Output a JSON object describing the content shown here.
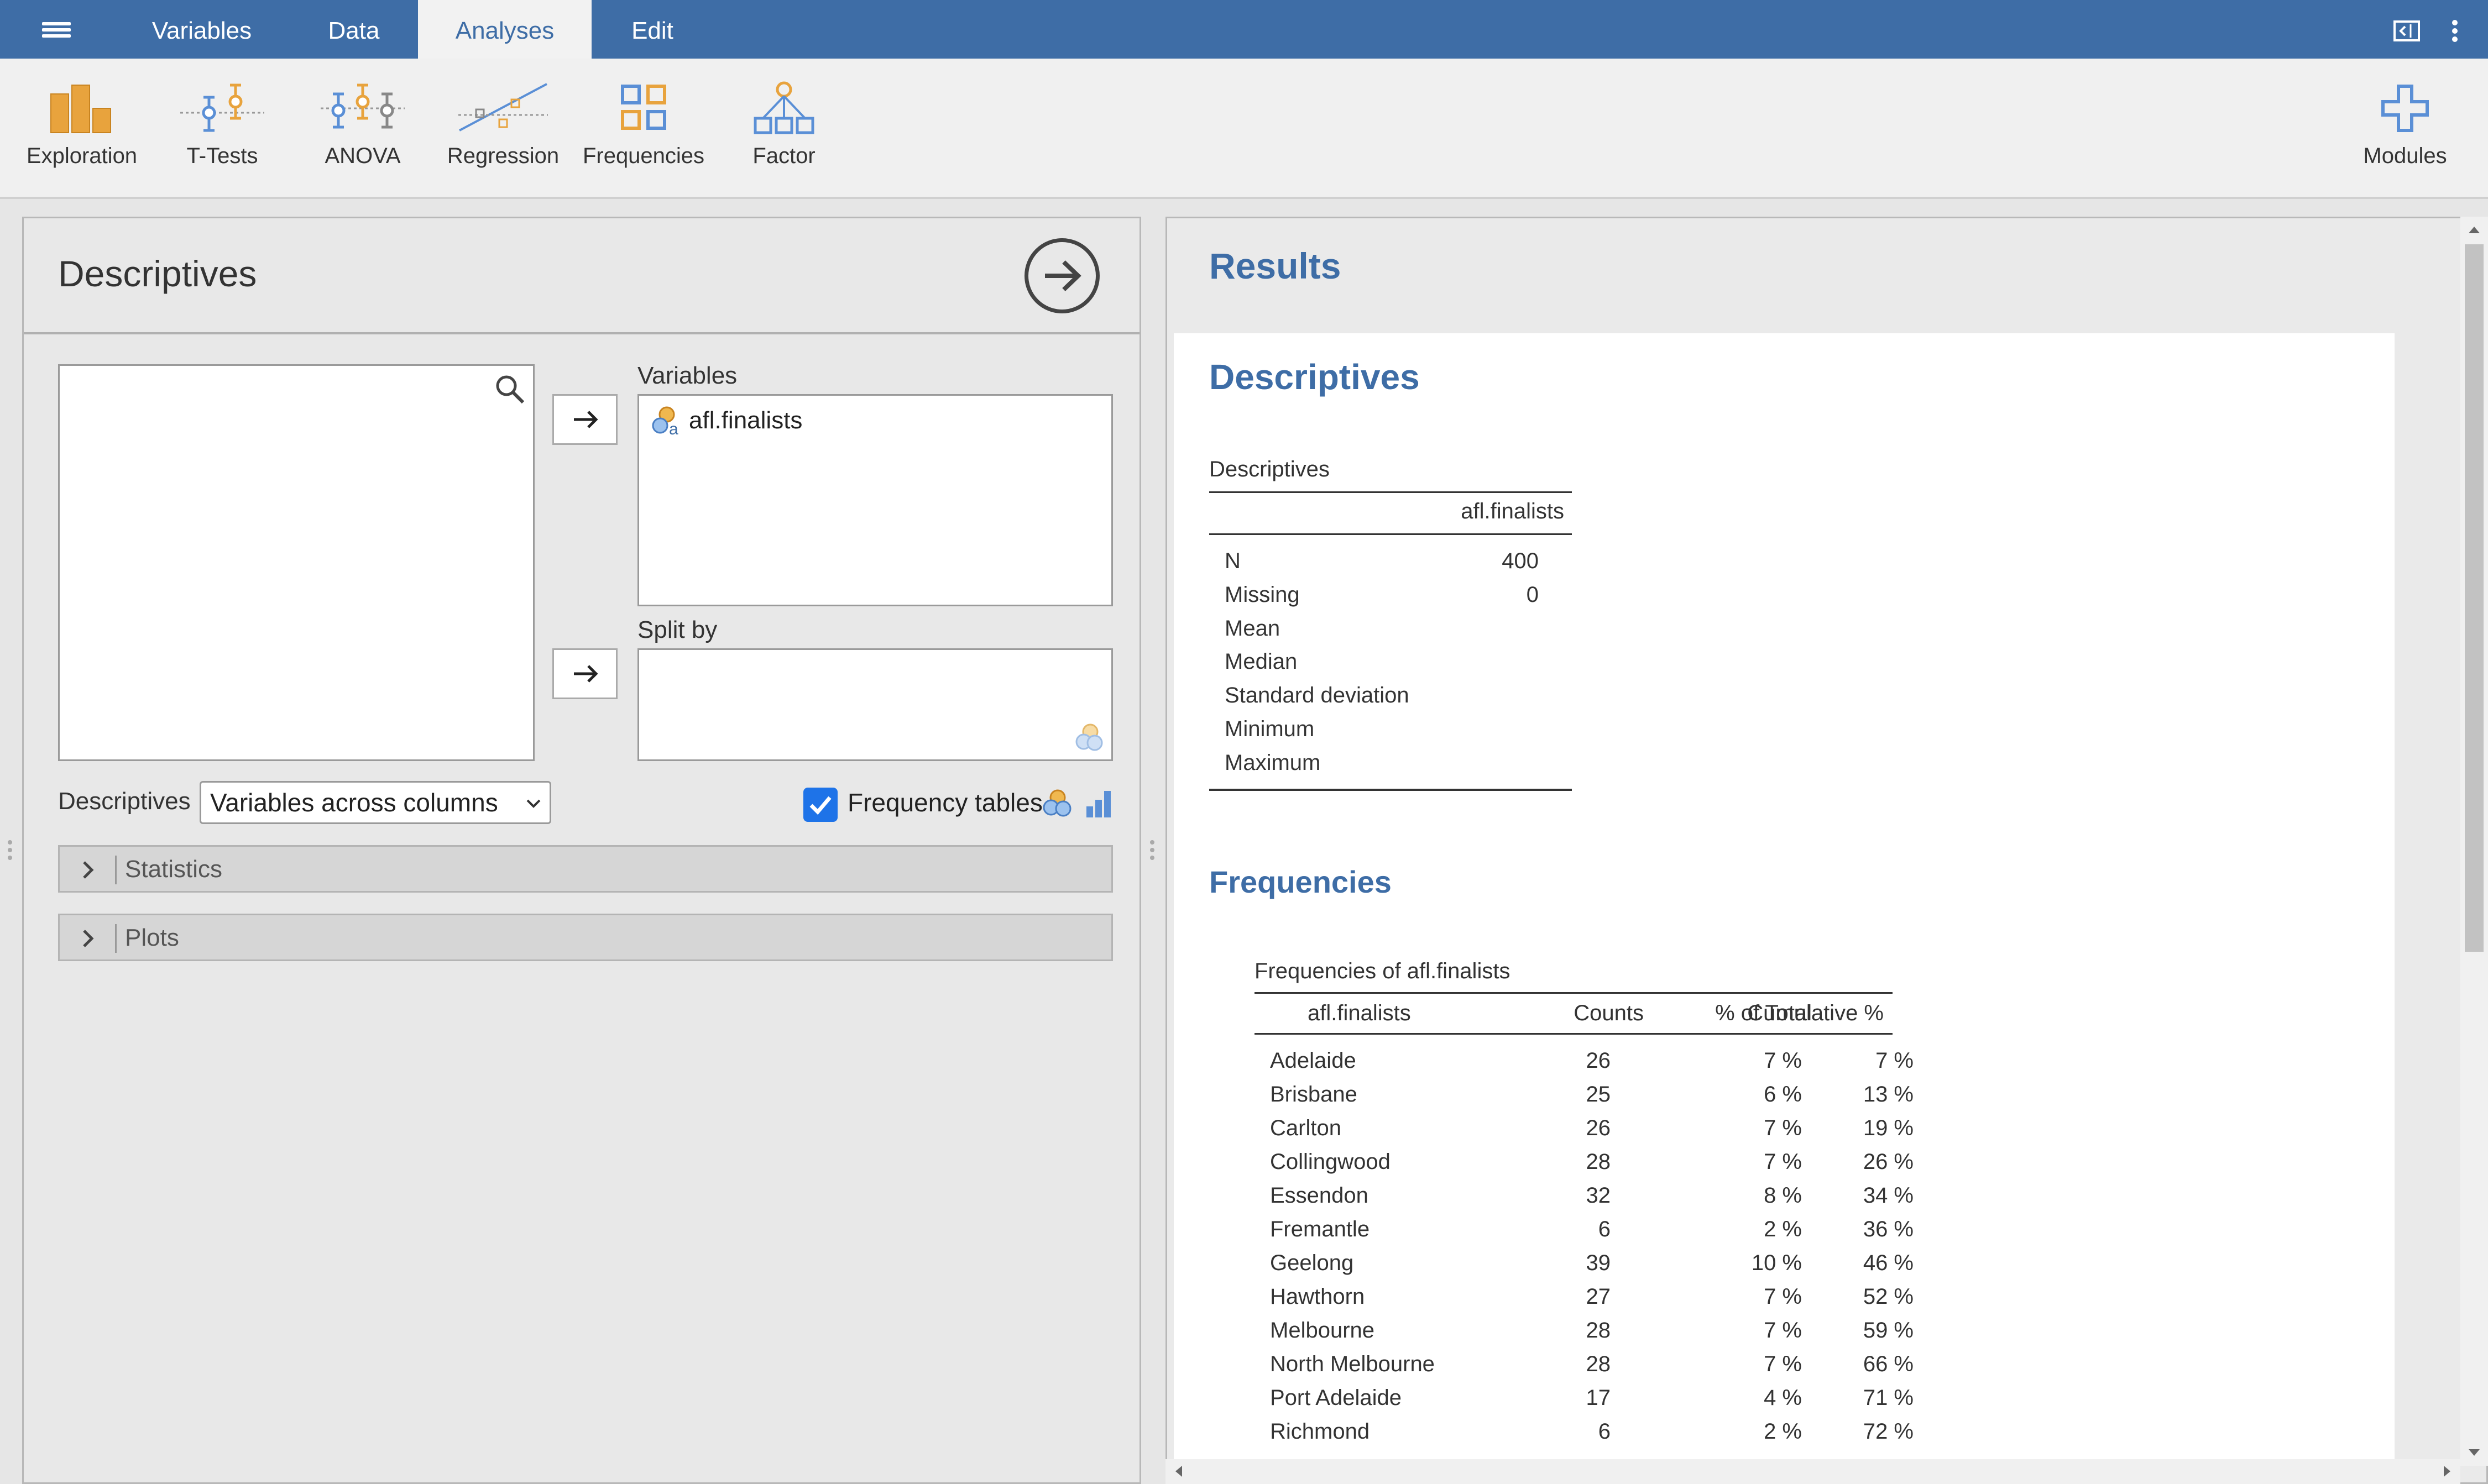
{
  "colors": {
    "brand_blue": "#3e6da6",
    "orange": "#e8a33d",
    "checkbox_blue": "#1e73e8"
  },
  "tabs": [
    {
      "label": "Variables"
    },
    {
      "label": "Data"
    },
    {
      "label": "Analyses"
    },
    {
      "label": "Edit"
    }
  ],
  "ribbon": {
    "items": [
      {
        "label": "Exploration",
        "icon": "exploration-icon"
      },
      {
        "label": "T-Tests",
        "icon": "t-tests-icon"
      },
      {
        "label": "ANOVA",
        "icon": "anova-icon"
      },
      {
        "label": "Regression",
        "icon": "regression-icon"
      },
      {
        "label": "Frequencies",
        "icon": "frequencies-icon"
      },
      {
        "label": "Factor",
        "icon": "factor-icon"
      }
    ],
    "modules_label": "Modules"
  },
  "options": {
    "title": "Descriptives",
    "variables_label": "Variables",
    "variables": [
      "afl.finalists"
    ],
    "splitby_label": "Split by",
    "descriptives_label": "Descriptives",
    "descriptives_select": "Variables across columns",
    "frequency_tables_label": "Frequency tables",
    "frequency_tables_checked": true,
    "sections": [
      {
        "label": "Statistics"
      },
      {
        "label": "Plots"
      }
    ]
  },
  "results": {
    "title": "Results",
    "descriptives_heading": "Descriptives",
    "desc_table": {
      "caption": "Descriptives",
      "column": "afl.finalists",
      "rows": [
        {
          "label": "N",
          "value": "400"
        },
        {
          "label": "Missing",
          "value": "0"
        },
        {
          "label": "Mean",
          "value": ""
        },
        {
          "label": "Median",
          "value": ""
        },
        {
          "label": "Standard deviation",
          "value": ""
        },
        {
          "label": "Minimum",
          "value": ""
        },
        {
          "label": "Maximum",
          "value": ""
        }
      ]
    },
    "frequencies_heading": "Frequencies",
    "freq_table": {
      "caption": "Frequencies of afl.finalists",
      "headers": [
        "afl.finalists",
        "Counts",
        "% of Total",
        "Cumulative %"
      ],
      "rows": [
        {
          "team": "Adelaide",
          "counts": "26",
          "pct": "7 %",
          "cum": "7 %"
        },
        {
          "team": "Brisbane",
          "counts": "25",
          "pct": "6 %",
          "cum": "13 %"
        },
        {
          "team": "Carlton",
          "counts": "26",
          "pct": "7 %",
          "cum": "19 %"
        },
        {
          "team": "Collingwood",
          "counts": "28",
          "pct": "7 %",
          "cum": "26 %"
        },
        {
          "team": "Essendon",
          "counts": "32",
          "pct": "8 %",
          "cum": "34 %"
        },
        {
          "team": "Fremantle",
          "counts": "6",
          "pct": "2 %",
          "cum": "36 %"
        },
        {
          "team": "Geelong",
          "counts": "39",
          "pct": "10 %",
          "cum": "46 %"
        },
        {
          "team": "Hawthorn",
          "counts": "27",
          "pct": "7 %",
          "cum": "52 %"
        },
        {
          "team": "Melbourne",
          "counts": "28",
          "pct": "7 %",
          "cum": "59 %"
        },
        {
          "team": "North Melbourne",
          "counts": "28",
          "pct": "7 %",
          "cum": "66 %"
        },
        {
          "team": "Port Adelaide",
          "counts": "17",
          "pct": "4 %",
          "cum": "71 %"
        },
        {
          "team": "Richmond",
          "counts": "6",
          "pct": "2 %",
          "cum": "72 %"
        }
      ]
    }
  }
}
